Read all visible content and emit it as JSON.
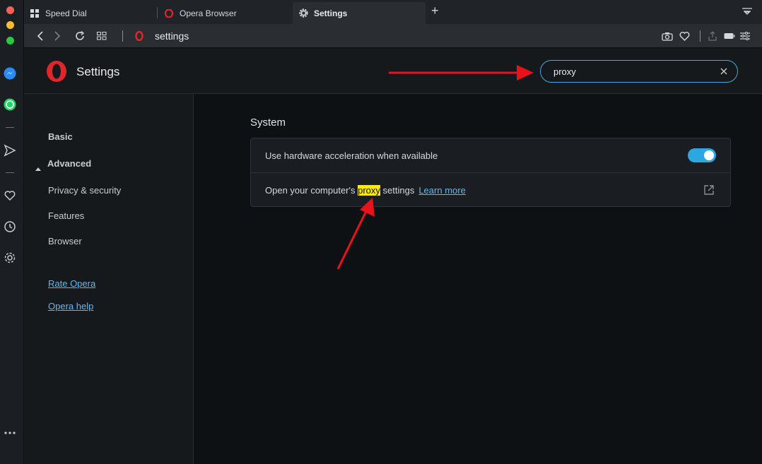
{
  "tabs": [
    {
      "label": "Speed Dial",
      "icon": "speed-dial-icon"
    },
    {
      "label": "Opera Browser",
      "icon": "opera-icon"
    },
    {
      "label": "Settings",
      "icon": "gear-icon"
    }
  ],
  "address": {
    "url": "settings"
  },
  "header": {
    "title": "Settings",
    "search_value": "proxy"
  },
  "nav": {
    "basic": "Basic",
    "advanced": "Advanced",
    "items": [
      "Privacy & security",
      "Features",
      "Browser"
    ],
    "links": [
      "Rate Opera",
      "Opera help"
    ]
  },
  "main": {
    "section_title": "System",
    "row1_label": "Use hardware acceleration when available",
    "row2_prefix": "Open your computer's ",
    "row2_highlight": "proxy",
    "row2_suffix": " settings",
    "row2_link": "Learn more",
    "hardware_acceleration_enabled": true
  },
  "colors": {
    "accent": "#2da7e0",
    "highlight": "#f6e81a",
    "annotation": "#e8131a"
  }
}
